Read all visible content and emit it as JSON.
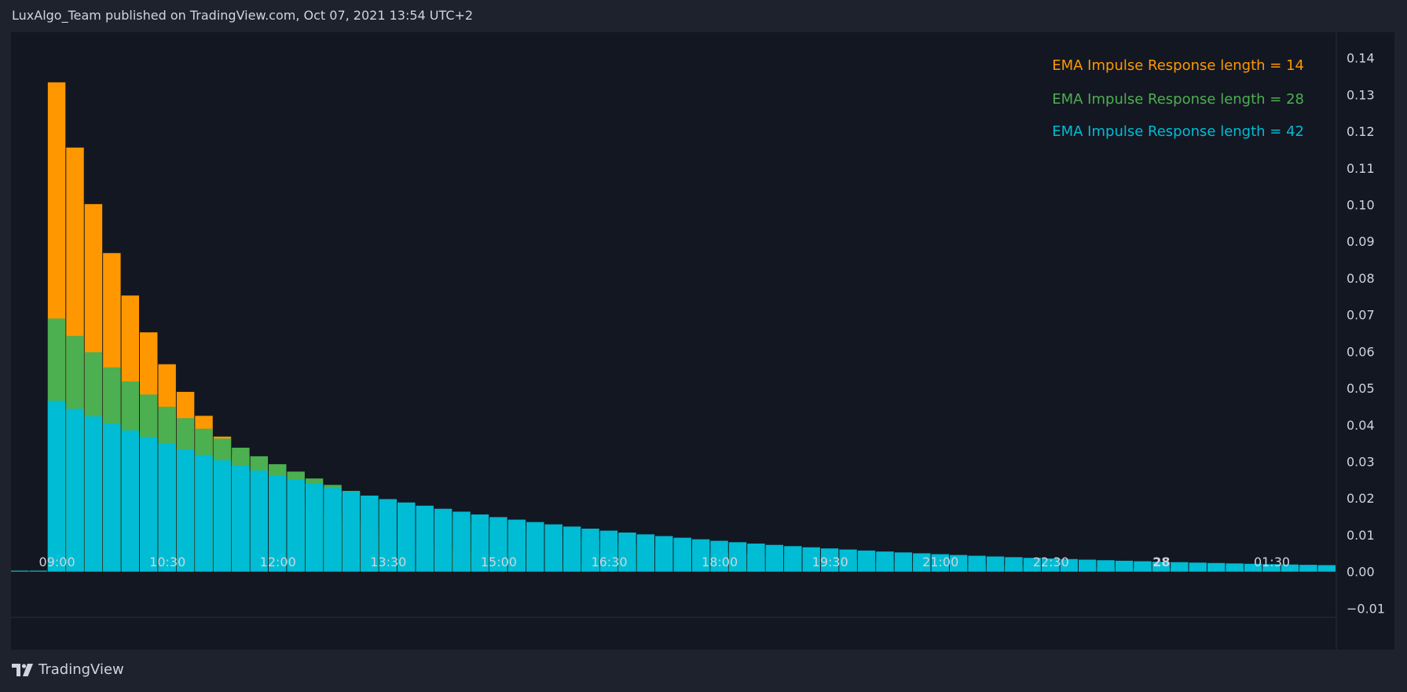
{
  "header": {
    "attribution": "LuxAlgo_Team published on TradingView.com, Oct 07, 2021 13:54 UTC+2"
  },
  "footer": {
    "brand": "TradingView",
    "logo_icon": "tradingview-logo-icon"
  },
  "colors": {
    "background": "#131722",
    "page": "#1e222d",
    "orange": "#ff9800",
    "green": "#4caf50",
    "cyan": "#00bcd4"
  },
  "chart_data": {
    "type": "bar",
    "stacking": "overlaid",
    "y_axis_position": "right",
    "ylim": [
      -0.0125,
      0.147
    ],
    "y_ticks": [
      "0.14",
      "0.13",
      "0.12",
      "0.11",
      "0.10",
      "0.09",
      "0.08",
      "0.07",
      "0.06",
      "0.05",
      "0.04",
      "0.03",
      "0.02",
      "0.01",
      "0.00",
      "−0.01"
    ],
    "y_tick_values": [
      0.14,
      0.13,
      0.12,
      0.11,
      0.1,
      0.09,
      0.08,
      0.07,
      0.06,
      0.05,
      0.04,
      0.03,
      0.02,
      0.01,
      0.0,
      -0.01
    ],
    "x_ticks": [
      "09:00",
      "10:30",
      "12:00",
      "13:30",
      "15:00",
      "16:30",
      "18:00",
      "19:30",
      "21:00",
      "22:30",
      "28",
      "01:30"
    ],
    "x_tick_bar_index": [
      2,
      8,
      14,
      20,
      26,
      32,
      38,
      44,
      50,
      56,
      62,
      68
    ],
    "bar_count": 72,
    "grid": false,
    "legend_position": "top-right",
    "series": [
      {
        "name": "EMA Impulse Response length = 14",
        "color": "#ff9800",
        "length": 14,
        "start_index": 2
      },
      {
        "name": "EMA Impulse Response length = 28",
        "color": "#4caf50",
        "length": 28,
        "start_index": 2
      },
      {
        "name": "EMA Impulse Response length = 42",
        "color": "#00bcd4",
        "length": 42,
        "start_index": 2
      }
    ]
  }
}
